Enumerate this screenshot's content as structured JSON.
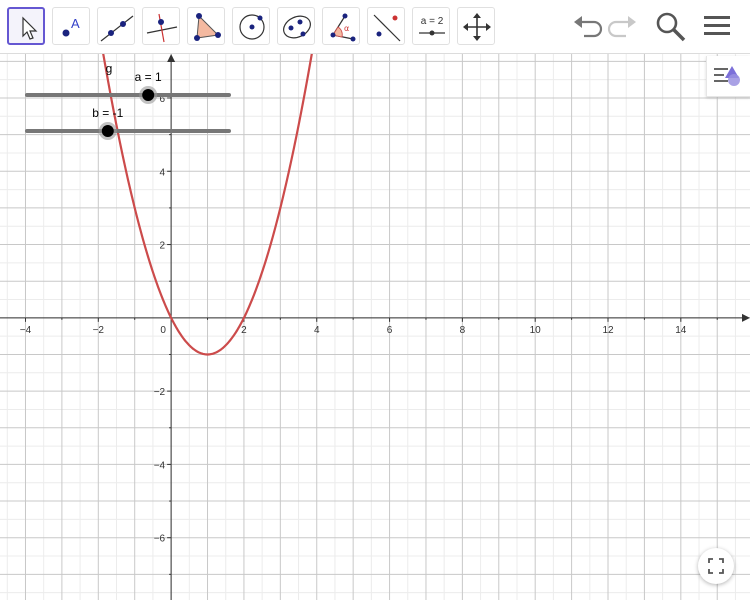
{
  "toolbar": {
    "tools": [
      {
        "name": "move-tool",
        "active": true
      },
      {
        "name": "point-tool",
        "label": "A"
      },
      {
        "name": "line-tool"
      },
      {
        "name": "perpendicular-line-tool"
      },
      {
        "name": "polygon-tool"
      },
      {
        "name": "circle-center-point-tool"
      },
      {
        "name": "ellipse-tool"
      },
      {
        "name": "angle-tool",
        "label": "α"
      },
      {
        "name": "reflect-tool"
      },
      {
        "name": "slider-tool",
        "label": "a = 2"
      },
      {
        "name": "move-graphics-view-tool"
      }
    ],
    "undo": "undo-icon",
    "redo": "redo-icon",
    "search": "search-icon",
    "menu": "menu-icon"
  },
  "graphics": {
    "function_label": "g",
    "function_color": "#cc4b4b",
    "sliders": [
      {
        "label": "a = 1",
        "value": 1,
        "min": -5,
        "max": 5
      },
      {
        "label": "b = -1",
        "value": -1,
        "min": -5,
        "max": 5
      }
    ],
    "x_tick_labels": [
      "−4",
      "−2",
      "0",
      "2",
      "4",
      "6",
      "8",
      "10",
      "12",
      "14"
    ],
    "y_tick_labels": [
      "6",
      "4",
      "2",
      "−2",
      "−4",
      "−6"
    ],
    "x_range": [
      -4.7,
      15.9
    ],
    "y_range": [
      -7.7,
      7.2
    ]
  },
  "style_bar": {
    "icon": "style-bar-toggle-icon"
  },
  "fullscreen": {
    "icon": "fullscreen-icon"
  }
}
